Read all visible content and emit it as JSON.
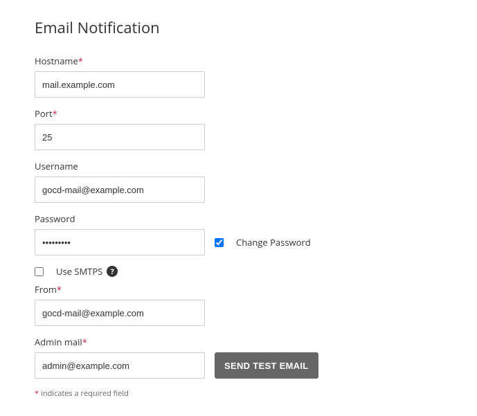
{
  "title": "Email Notification",
  "fields": {
    "hostname": {
      "label": "Hostname",
      "required": true,
      "value": "mail.example.com"
    },
    "port": {
      "label": "Port",
      "required": true,
      "value": "25"
    },
    "username": {
      "label": "Username",
      "required": false,
      "value": "gocd-mail@example.com"
    },
    "password": {
      "label": "Password",
      "required": false,
      "value": "•••••••••"
    },
    "change_password": {
      "label": "Change Password",
      "checked": true
    },
    "use_smtps": {
      "label": "Use SMTPS",
      "checked": false
    },
    "from": {
      "label": "From",
      "required": true,
      "value": "gocd-mail@example.com"
    },
    "admin_mail": {
      "label": "Admin mail",
      "required": true,
      "value": "admin@example.com"
    }
  },
  "actions": {
    "send_test_email": "SEND TEST EMAIL"
  },
  "footnote": {
    "star": "*",
    "text": " indicates a required field"
  }
}
